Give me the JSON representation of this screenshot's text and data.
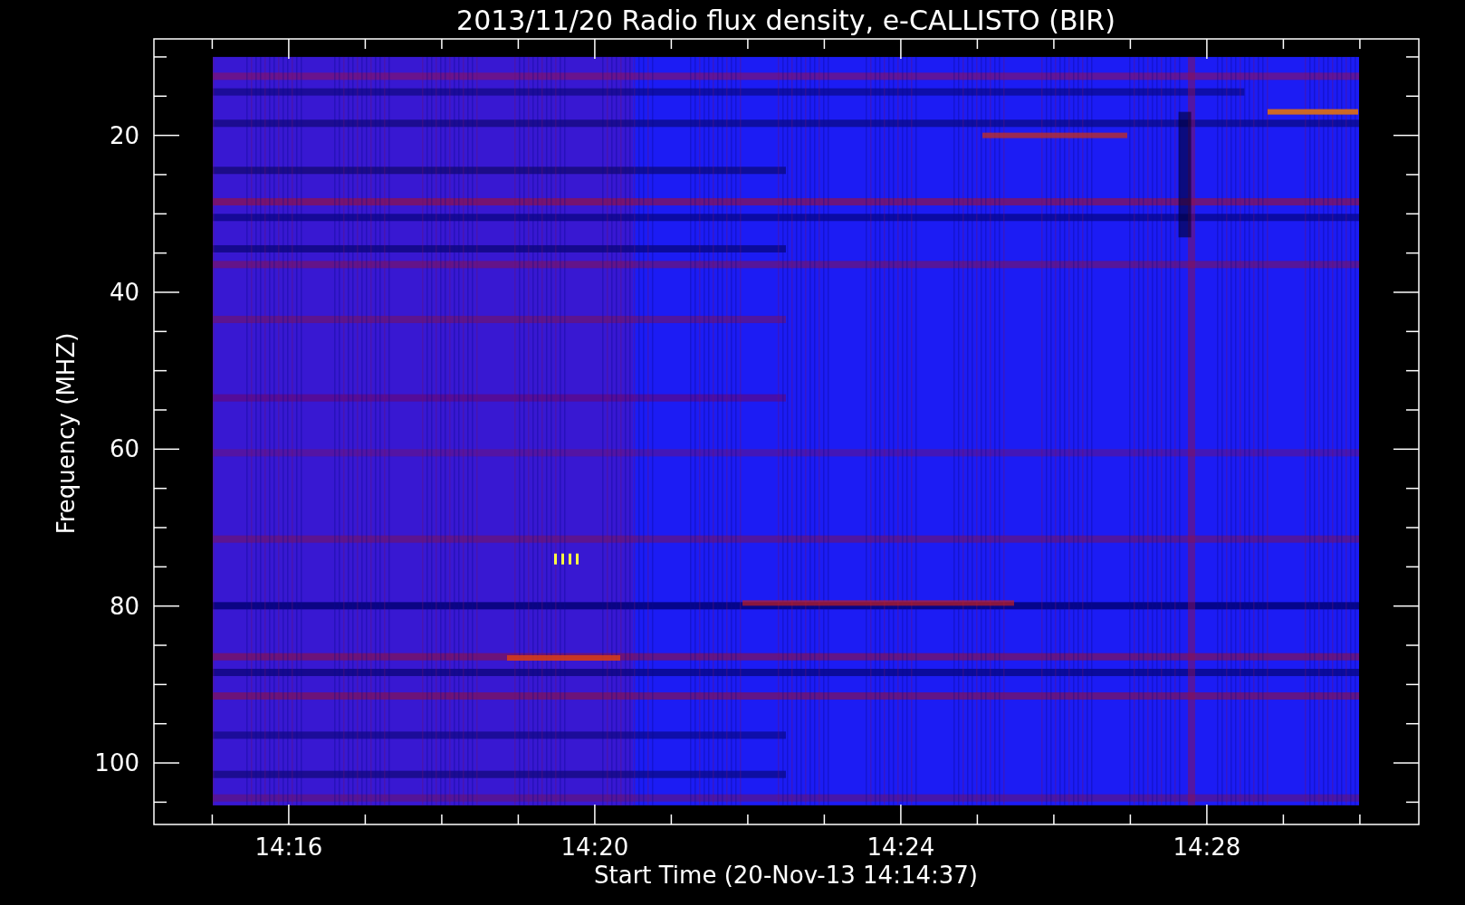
{
  "title": "2013/11/20  Radio flux density, e-CALLISTO (BIR)",
  "x_axis": {
    "label": "Start Time (20-Nov-13 14:14:37)",
    "tick_labels": [
      "14:16",
      "14:20",
      "14:24",
      "14:28"
    ]
  },
  "y_axis": {
    "label": "Frequency (MHZ)",
    "tick_labels": [
      "20",
      "40",
      "60",
      "80",
      "100"
    ]
  }
}
